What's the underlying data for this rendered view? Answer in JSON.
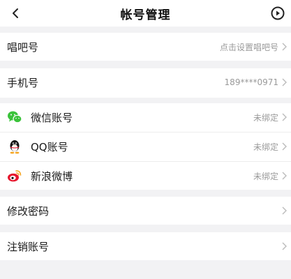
{
  "header": {
    "title": "帐号管理"
  },
  "rows": {
    "changba_id": {
      "label": "唱吧号",
      "value": "点击设置唱吧号"
    },
    "phone": {
      "label": "手机号",
      "value": "189****0971"
    },
    "wechat": {
      "label": "微信账号",
      "value": "未绑定"
    },
    "qq": {
      "label": "QQ账号",
      "value": "未绑定"
    },
    "weibo": {
      "label": "新浪微博",
      "value": "未绑定"
    },
    "change_password": {
      "label": "修改密码"
    },
    "cancel_account": {
      "label": "注销账号"
    }
  },
  "icons": {
    "back": "chevron-left-icon",
    "play": "play-circle-icon",
    "wechat": "wechat-icon",
    "qq": "qq-penguin-icon",
    "weibo": "weibo-icon",
    "chevron": "chevron-right-icon"
  },
  "colors": {
    "background": "#f2f2f4",
    "card": "#ffffff",
    "wechat_green": "#3bc33b",
    "weibo_red": "#e6162d",
    "weibo_orange": "#f5a623",
    "secondary_text": "#9a9a9a"
  }
}
